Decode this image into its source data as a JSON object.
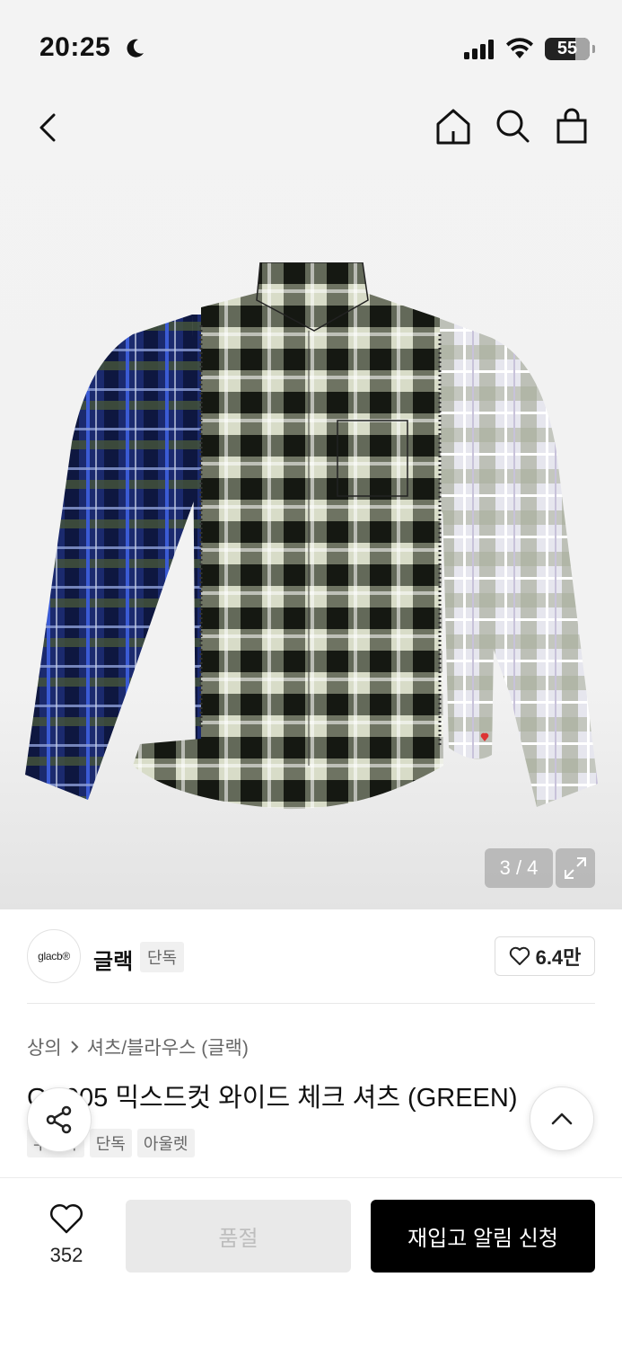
{
  "status_bar": {
    "time": "20:25",
    "battery": "55"
  },
  "gallery": {
    "counter": "3 / 4"
  },
  "brand": {
    "logo_text": "glacb®",
    "name": "글랙",
    "badge": "단독",
    "like_count": "6.4만"
  },
  "breadcrumb": {
    "category": "상의",
    "subcategory": "셔츠/블라우스 (글랙)"
  },
  "product": {
    "title": "GS005 믹스드컷 와이드 체크 셔츠 (GREEN)",
    "tags": [
      "무신사",
      "단독",
      "아울렛"
    ]
  },
  "bottom_bar": {
    "wish_count": "352",
    "soldout_label": "품절",
    "restock_label": "재입고 알림 신청"
  },
  "icons": [
    "moon-icon",
    "signal-icon",
    "wifi-icon",
    "back-icon",
    "home-icon",
    "search-icon",
    "bag-icon",
    "expand-icon",
    "heart-icon",
    "chevron-right-icon",
    "share-icon",
    "chevron-up-icon"
  ]
}
